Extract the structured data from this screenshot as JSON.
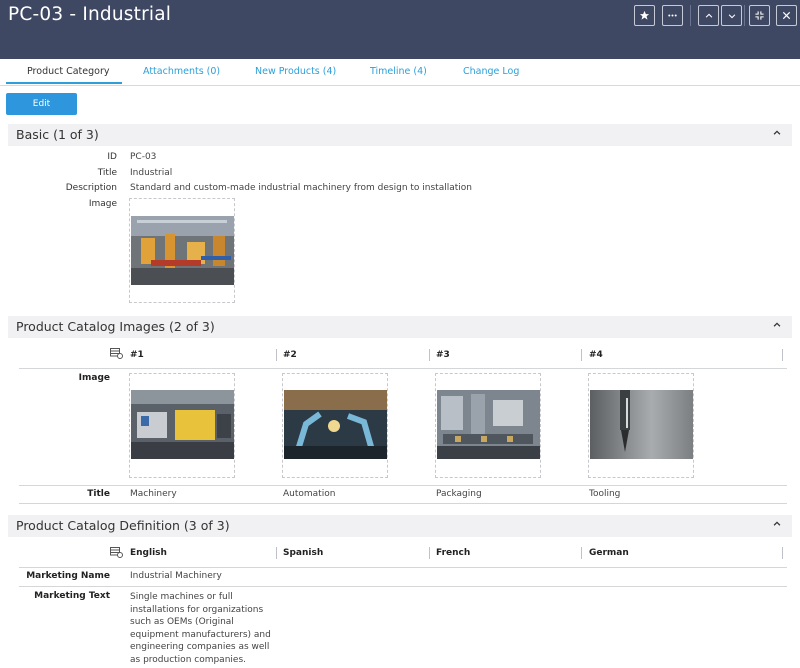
{
  "header": {
    "title": "PC-03 - Industrial",
    "icons": [
      "star-icon",
      "more-icon",
      "chevron-up-icon",
      "chevron-down-icon",
      "collapse-icon",
      "close-icon"
    ]
  },
  "tabs": [
    {
      "label": "Product Category",
      "active": true
    },
    {
      "label": "Attachments (0)"
    },
    {
      "label": "New Products (4)"
    },
    {
      "label": "Timeline (4)"
    },
    {
      "label": "Change Log"
    }
  ],
  "edit_label": "Edit",
  "basic": {
    "title": "Basic (1 of 3)",
    "fields": [
      {
        "label": "ID",
        "value": "PC-03"
      },
      {
        "label": "Title",
        "value": "Industrial"
      },
      {
        "label": "Description",
        "value": "Standard and custom-made industrial machinery from design to installation"
      }
    ],
    "image_label": "Image"
  },
  "images_section": {
    "title": "Product Catalog Images (2 of 3)",
    "columns": [
      "#1",
      "#2",
      "#3",
      "#4"
    ],
    "image_label": "Image",
    "title_label": "Title",
    "titles": [
      "Machinery",
      "Automation",
      "Packaging",
      "Tooling"
    ]
  },
  "definition": {
    "title": "Product Catalog Definition (3 of 3)",
    "columns": [
      "English",
      "Spanish",
      "French",
      "German"
    ],
    "marketing_name_label": "Marketing Name",
    "marketing_name": "Industrial Machinery",
    "marketing_text_label": "Marketing Text",
    "marketing_text_lines": [
      "Single machines or full",
      "installations for organizations",
      "such as OEMs (Original",
      "equipment manufacturers) and",
      "engineering companies as well",
      "as production companies."
    ]
  },
  "colors": {
    "header_bg": "#3f4863",
    "accent": "#2d9fd9",
    "edit_button": "#2d96dc",
    "section_bg": "#f1f1f3"
  }
}
